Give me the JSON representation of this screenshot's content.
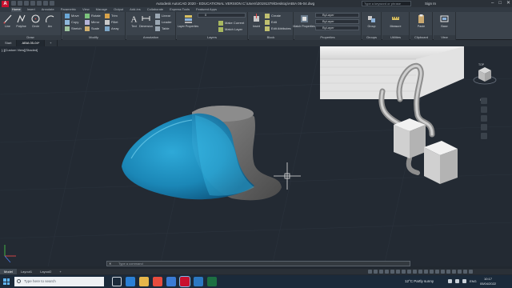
{
  "app": {
    "title": "Autodesk AutoCAD 2020 - EDUCATIONAL VERSION   C:\\Users\\20191379\\Desktop\\ABIA 05-04.dwg",
    "search_placeholder": "Type a keyword or phrase",
    "user": "Sign In",
    "icon_letter": "A",
    "window_controls": [
      "–",
      "□",
      "✕"
    ]
  },
  "menu_tabs": [
    "Home",
    "Insert",
    "Annotate",
    "Parametric",
    "View",
    "Manage",
    "Output",
    "Add-ins",
    "Collaborate",
    "Express Tools",
    "Featured Apps"
  ],
  "ribbon": {
    "draw": {
      "title": "Draw",
      "line": "Line",
      "polyline": "Polyline",
      "circle": "Circle",
      "arc": "Arc"
    },
    "modify": {
      "title": "Modify",
      "move": "Move",
      "rotate": "Rotate",
      "trim": "Trim",
      "copy": "Copy",
      "mirror": "Mirror",
      "fillet": "Fillet",
      "stretch": "Stretch",
      "scale": "Scale",
      "array": "Array"
    },
    "annotation": {
      "title": "Annotation",
      "text": "Text",
      "dimension": "Dimension",
      "linear": "Linear",
      "leader": "Leader",
      "table": "Table"
    },
    "layers": {
      "title": "Layers",
      "layer_properties": "Layer Properties",
      "make_current": "Make Current",
      "match_layer": "Match Layer",
      "current_layer": "0"
    },
    "block": {
      "title": "Block",
      "insert": "Insert",
      "create": "Create",
      "edit": "Edit",
      "edit_attributes": "Edit Attributes"
    },
    "properties": {
      "title": "Properties",
      "match_properties": "Match Properties",
      "color": "ByLayer",
      "linetype": "ByLayer",
      "lineweight": "ByLayer"
    },
    "groups": {
      "title": "Groups",
      "group": "Group"
    },
    "utilities": {
      "title": "Utilities",
      "measure": "Measure"
    },
    "clipboard": {
      "title": "Clipboard",
      "paste": "Paste"
    },
    "view": {
      "title": "View",
      "base": "Base"
    }
  },
  "file_tabs": [
    "Start",
    "ABIA 05-04*",
    "+"
  ],
  "viewport": {
    "label": "[-][Custom View][Shaded]",
    "cube_label": "TOP",
    "wcs_label": "WCS"
  },
  "command_line": {
    "placeholder": "Type a command",
    "close": "✕"
  },
  "layout_tabs": [
    "Model",
    "Layout1",
    "Layout2",
    "+"
  ],
  "taskbar": {
    "search_placeholder": "Type here to search",
    "weather": "12°C  Partly sunny",
    "language": "ENG",
    "time": "10:17",
    "date": "05/04/2022"
  },
  "colors": {
    "viewport_bg": "#232a33",
    "ribbon_bg": "#3b434c",
    "shell_blue": "#1e8fc4",
    "model_gray": "#707070",
    "taskbar_bg": "#1b2a3a"
  }
}
